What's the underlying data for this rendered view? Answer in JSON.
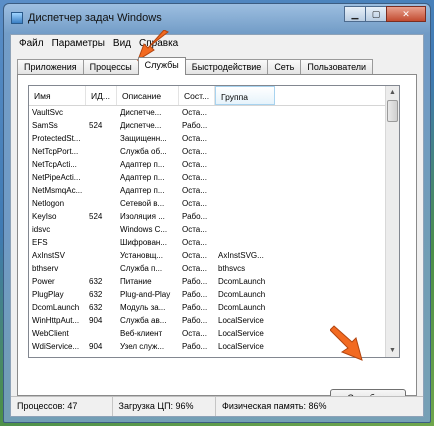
{
  "window": {
    "title": "Диспетчер задач Windows"
  },
  "menu": [
    "Файл",
    "Параметры",
    "Вид",
    "Справка"
  ],
  "tabs": [
    "Приложения",
    "Процессы",
    "Службы",
    "Быстродействие",
    "Сеть",
    "Пользователи"
  ],
  "active_tab": "Службы",
  "table": {
    "headers": [
      "Имя",
      "ИД...",
      "Описание",
      "Сост...",
      "Группа"
    ],
    "rows": [
      [
        "VaultSvc",
        "",
        "Диспетче...",
        "Оста...",
        ""
      ],
      [
        "SamSs",
        "524",
        "Диспетче...",
        "Рабо...",
        ""
      ],
      [
        "ProtectedSt...",
        "",
        "Защищенн...",
        "Оста...",
        ""
      ],
      [
        "NetTcpPort...",
        "",
        "Служба об...",
        "Оста...",
        ""
      ],
      [
        "NetTcpActi...",
        "",
        "Адаптер п...",
        "Оста...",
        ""
      ],
      [
        "NetPipeActi...",
        "",
        "Адаптер п...",
        "Оста...",
        ""
      ],
      [
        "NetMsmqAc...",
        "",
        "Адаптер п...",
        "Оста...",
        ""
      ],
      [
        "Netlogon",
        "",
        "Сетевой в...",
        "Оста...",
        ""
      ],
      [
        "KeyIso",
        "524",
        "Изоляция ...",
        "Рабо...",
        ""
      ],
      [
        "idsvc",
        "",
        "Windows C...",
        "Оста...",
        ""
      ],
      [
        "EFS",
        "",
        "Шифрован...",
        "Оста...",
        ""
      ],
      [
        "AxInstSV",
        "",
        "Установщ...",
        "Оста...",
        "AxInstSVG..."
      ],
      [
        "bthserv",
        "",
        "Служба п...",
        "Оста...",
        "bthsvcs"
      ],
      [
        "Power",
        "632",
        "Питание",
        "Рабо...",
        "DcomLaunch"
      ],
      [
        "PlugPlay",
        "632",
        "Plug-and-Play",
        "Рабо...",
        "DcomLaunch"
      ],
      [
        "DcomLaunch",
        "632",
        "Модуль за...",
        "Рабо...",
        "DcomLaunch"
      ],
      [
        "WinHttpAut...",
        "904",
        "Служба ав...",
        "Рабо...",
        "LocalService"
      ],
      [
        "WebClient",
        "",
        "Веб-клиент",
        "Оста...",
        "LocalService"
      ],
      [
        "WdiService...",
        "904",
        "Узел служ...",
        "Рабо...",
        "LocalService"
      ]
    ]
  },
  "services_button": "Службы...",
  "status": {
    "processes": "Процессов: 47",
    "cpu": "Загрузка ЦП: 96%",
    "memory": "Физическая память: 86%"
  },
  "colors": {
    "arrow": "#f26a21",
    "tab_active": "#ffffff"
  }
}
